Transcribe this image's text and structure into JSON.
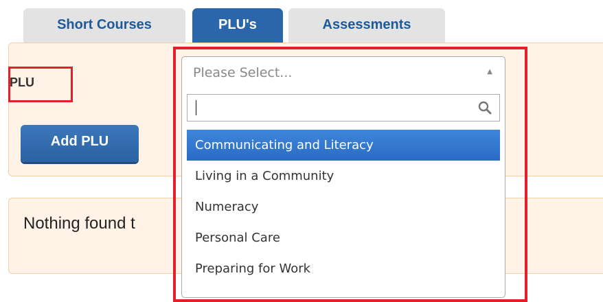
{
  "tabs": [
    {
      "label": "Short Courses",
      "active": false
    },
    {
      "label": "PLU's",
      "active": true
    },
    {
      "label": "Assessments",
      "active": false
    }
  ],
  "plu_section": {
    "label": "PLU",
    "add_button_label": "Add PLU"
  },
  "results": {
    "empty_message": "Nothing found t"
  },
  "plu_select": {
    "placeholder": "Please Select...",
    "search_value": "",
    "options": [
      {
        "label": "Communicating and Literacy",
        "highlighted": true
      },
      {
        "label": "Living in a Community",
        "highlighted": false
      },
      {
        "label": "Numeracy",
        "highlighted": false
      },
      {
        "label": "Personal Care",
        "highlighted": false
      },
      {
        "label": "Preparing for Work",
        "highlighted": false
      }
    ]
  },
  "colors": {
    "tab_active": "#2a66a9",
    "tab_inactive": "#e3e3e3",
    "panel_bg": "#fef3e6",
    "highlight_red": "#e2202c",
    "option_selected": "#3479d0"
  },
  "icons": {
    "search": "search-icon",
    "dropdown_arrow": "triangle-up-icon"
  }
}
